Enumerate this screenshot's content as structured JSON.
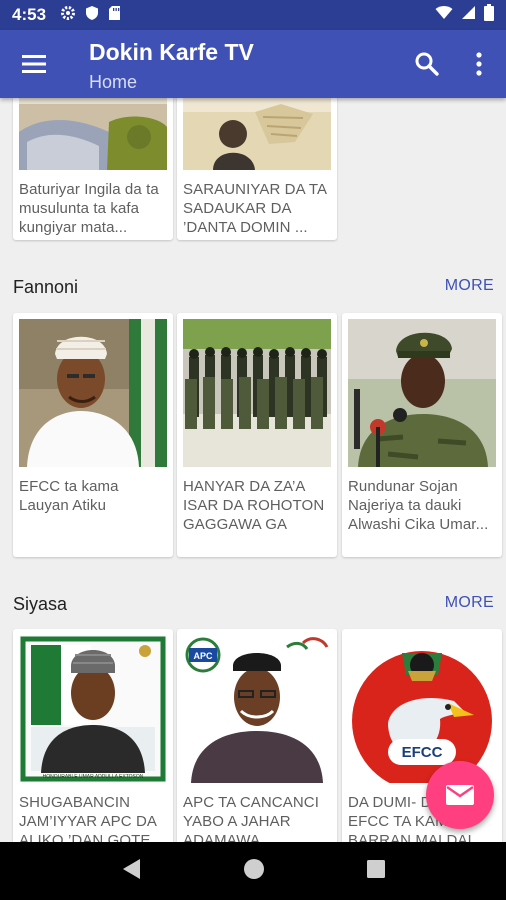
{
  "status_bar": {
    "time": "4:53"
  },
  "app_bar": {
    "title": "Dokin Karfe TV",
    "subtitle": "Home"
  },
  "top_cards": [
    {
      "title": "Baturiyar Ingila da ta musulunta ta kafa kungiyar mata..."
    },
    {
      "title": "SARAUNIYAR DA TA SADAUKAR DA ’DANTA DOMIN ..."
    }
  ],
  "sections": [
    {
      "title": "Fannoni",
      "more_label": "MORE",
      "cards": [
        {
          "title": "EFCC ta kama Lauyan Atiku"
        },
        {
          "title": "HANYAR DA ZA’A ISAR DA ROHOTON GAGGAWA GA RUN..."
        },
        {
          "title": "Rundunar Sojan Najeriya ta dauki Alwashi Cika Umar..."
        }
      ]
    },
    {
      "title": "Siyasa",
      "more_label": "MORE",
      "cards": [
        {
          "title": "SHUGABANCIN JAM’IYYAR APC DA ALIKO ’DAN GOTE..."
        },
        {
          "title": "APC TA CANCANCI YABO A JAHAR ADAMAWA"
        },
        {
          "title": "DA DUMI- DUMI EFCC TA KAMA BARRAN MALDAI..."
        }
      ]
    }
  ],
  "image_texts": {
    "poster_caption": "HONOURABLE UMAR ADDULLA EXTOSON",
    "apc_logo": "APC",
    "efcc_logo": "EFCC"
  },
  "colors": {
    "primary": "#3f51b5",
    "status_bar": "#2c3e93",
    "accent": "#ff3f80",
    "background": "#efefef",
    "card_text": "#5f5f5f"
  },
  "icons": [
    "menu-icon",
    "search-icon",
    "more-vert-icon",
    "mail-icon",
    "back-icon",
    "home-icon",
    "recents-icon",
    "wifi-icon",
    "signal-icon",
    "battery-icon",
    "settings-icon",
    "shield-icon",
    "sd-card-icon"
  ]
}
